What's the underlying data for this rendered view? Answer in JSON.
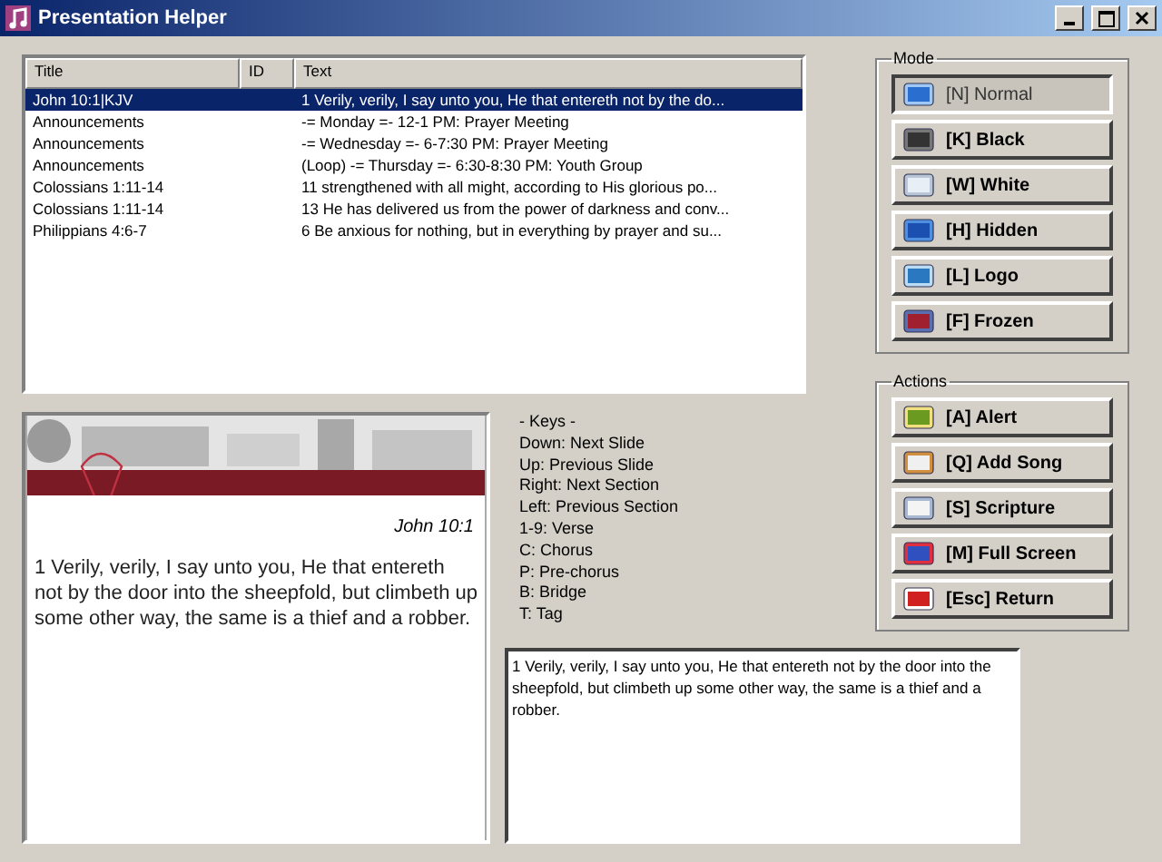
{
  "window": {
    "title": "Presentation Helper"
  },
  "table": {
    "columns": [
      "Title",
      "ID",
      "Text"
    ],
    "rows": [
      {
        "title": "John 10:1|KJV",
        "text": "1 Verily, verily, I say unto you, He that entereth not by the do...",
        "selected": true
      },
      {
        "title": "Announcements",
        "text": "-= Monday =- 12-1 PM: Prayer Meeting",
        "selected": false
      },
      {
        "title": "Announcements",
        "text": "-= Wednesday =- 6-7:30 PM: Prayer Meeting",
        "selected": false
      },
      {
        "title": "Announcements",
        "text": "(Loop) -= Thursday =- 6:30-8:30 PM: Youth Group",
        "selected": false
      },
      {
        "title": "Colossians 1:11-14",
        "text": "11 strengthened with all might, according to His glorious po...",
        "selected": false
      },
      {
        "title": "Colossians 1:11-14",
        "text": "13 He has delivered us from the power of darkness and conv...",
        "selected": false
      },
      {
        "title": "Philippians 4:6-7",
        "text": "6 Be anxious for nothing, but in everything by prayer and su...",
        "selected": false
      }
    ]
  },
  "mode": {
    "title": "Mode",
    "buttons": [
      {
        "label": "[N] Normal",
        "kind": "normal",
        "selected": true
      },
      {
        "label": "[K] Black",
        "kind": "black",
        "selected": false
      },
      {
        "label": "[W] White",
        "kind": "white",
        "selected": false
      },
      {
        "label": "[H] Hidden",
        "kind": "hidden",
        "selected": false
      },
      {
        "label": "[L] Logo",
        "kind": "logo",
        "selected": false
      },
      {
        "label": "[F] Frozen",
        "kind": "frozen",
        "selected": false
      }
    ]
  },
  "actions": {
    "title": "Actions",
    "buttons": [
      {
        "label": "[A] Alert",
        "kind": "alert"
      },
      {
        "label": "[Q] Add Song",
        "kind": "song"
      },
      {
        "label": "[S] Scripture",
        "kind": "scripture"
      },
      {
        "label": "[M] Full Screen",
        "kind": "fullscreen"
      },
      {
        "label": "[Esc] Return",
        "kind": "return"
      }
    ]
  },
  "preview": {
    "reference": "John 10:1",
    "text": "1 Verily, verily, I say unto you, He that entereth not by the door into the sheepfold, but climbeth up some other way, the same is a thief and a robber."
  },
  "keys": [
    "- Keys -",
    "Down: Next Slide",
    "Up: Previous Slide",
    "Right: Next Section",
    "Left: Previous Section",
    "1-9: Verse",
    "C: Chorus",
    "P: Pre-chorus",
    "B: Bridge",
    "T: Tag"
  ],
  "editor": {
    "value": "1 Verily, verily, I say unto you, He that entereth not by the door into the sheepfold, but climbeth up some other way, the same is a thief and a robber."
  }
}
